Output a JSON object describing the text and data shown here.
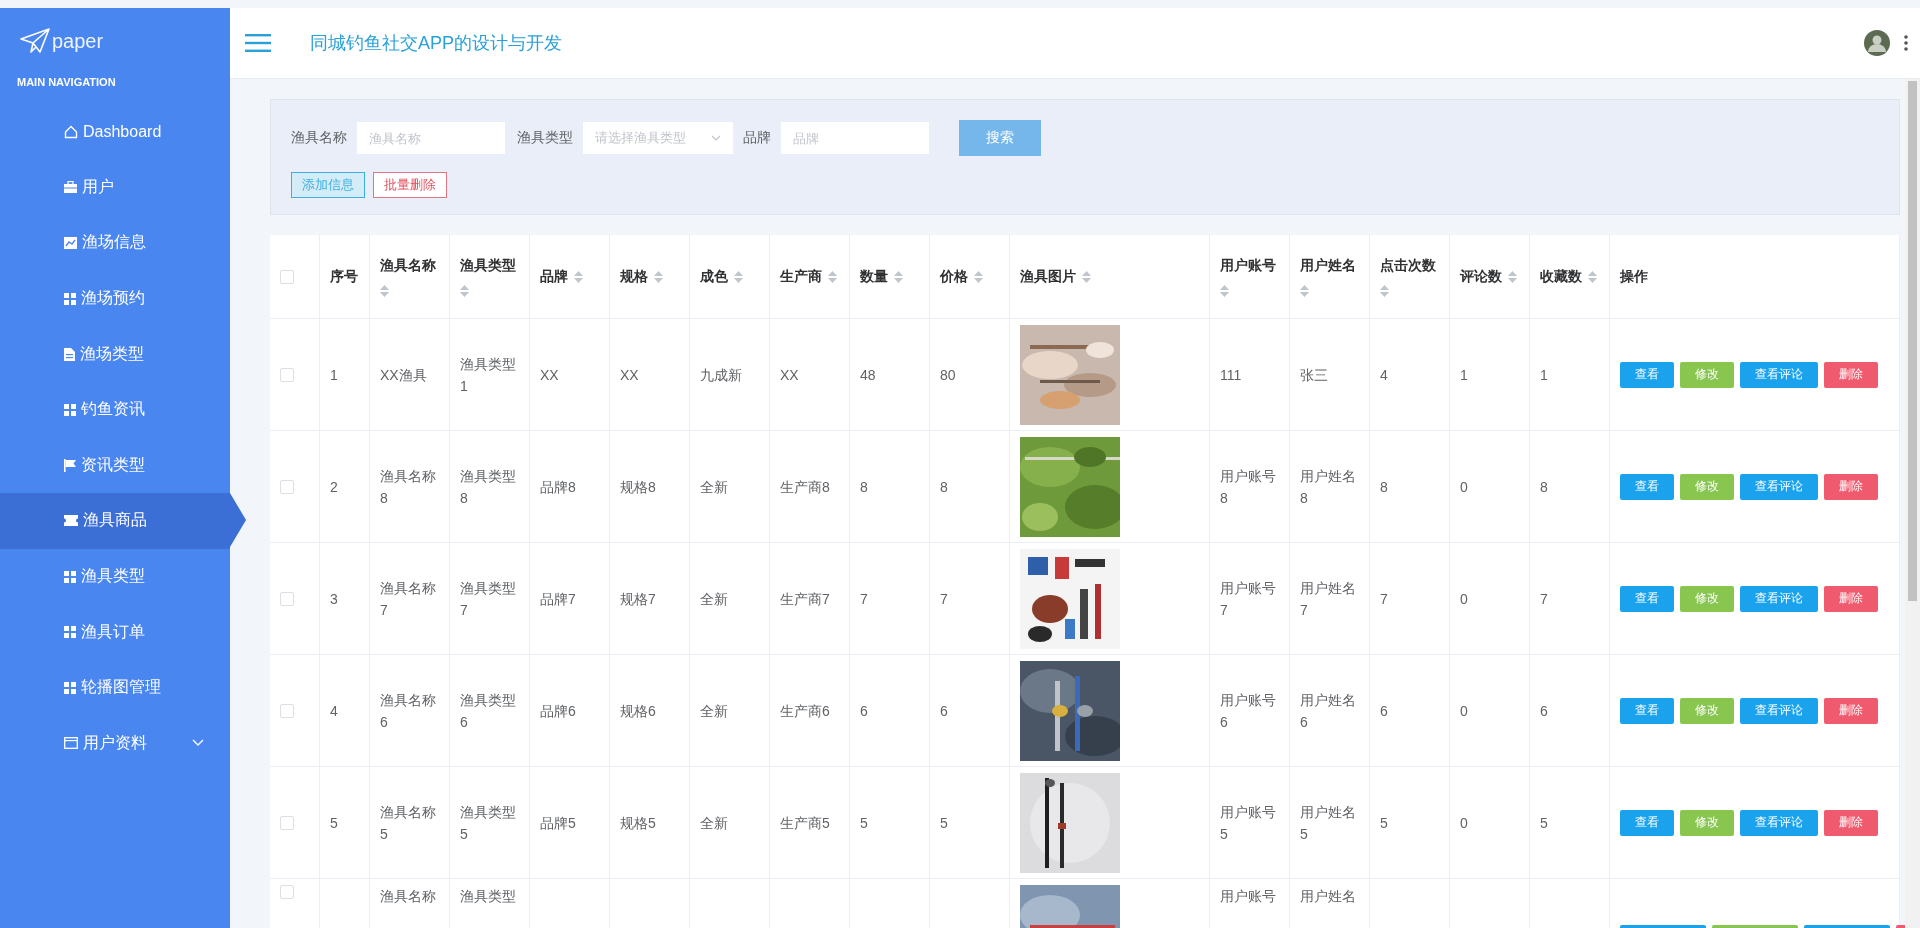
{
  "sidebar": {
    "logo": "paper",
    "heading": "MAIN NAVIGATION",
    "items": [
      {
        "label": "Dashboard",
        "selected": false
      },
      {
        "label": "用户",
        "selected": false
      },
      {
        "label": "渔场信息",
        "selected": false
      },
      {
        "label": "渔场预约",
        "selected": false
      },
      {
        "label": "渔场类型",
        "selected": false
      },
      {
        "label": "钓鱼资讯",
        "selected": false
      },
      {
        "label": "资讯类型",
        "selected": false
      },
      {
        "label": "渔具商品",
        "selected": true
      },
      {
        "label": "渔具类型",
        "selected": false
      },
      {
        "label": "渔具订单",
        "selected": false
      },
      {
        "label": "轮播图管理",
        "selected": false
      },
      {
        "label": "用户资料",
        "selected": false,
        "expanded": false
      }
    ]
  },
  "header": {
    "title": "同城钓鱼社交APP的设计与开发"
  },
  "filters": [
    {
      "label": "渔具名称",
      "kind": "input",
      "placeholder": "渔具名称"
    },
    {
      "label": "渔具类型",
      "kind": "select",
      "placeholder": "请选择渔具类型"
    },
    {
      "label": "品牌",
      "kind": "input",
      "placeholder": "品牌"
    }
  ],
  "search_button": "搜索",
  "toolbar": [
    {
      "label": "添加信息",
      "kind": "add"
    },
    {
      "label": "批量删除",
      "kind": "delete"
    }
  ],
  "table": {
    "header_checked": false,
    "columns": [
      {
        "kind": "check"
      },
      {
        "kind": "text",
        "label": "序号",
        "sortable": false
      },
      {
        "kind": "text",
        "label": "渔具名称",
        "sortable": true
      },
      {
        "kind": "text",
        "label": "渔具类型",
        "sortable": true
      },
      {
        "kind": "text",
        "label": "品牌",
        "sortable": true
      },
      {
        "kind": "text",
        "label": "规格",
        "sortable": true
      },
      {
        "kind": "text",
        "label": "成色",
        "sortable": true
      },
      {
        "kind": "text",
        "label": "生产商",
        "sortable": true
      },
      {
        "kind": "text",
        "label": "数量",
        "sortable": true
      },
      {
        "kind": "text",
        "label": "价格",
        "sortable": true
      },
      {
        "kind": "picture",
        "label": "渔具图片",
        "sortable": true
      },
      {
        "kind": "text",
        "label": "用户账号",
        "sortable": true
      },
      {
        "kind": "text",
        "label": "用户姓名",
        "sortable": true
      },
      {
        "kind": "text",
        "label": "点击次数",
        "sortable": true
      },
      {
        "kind": "text",
        "label": "评论数",
        "sortable": true
      },
      {
        "kind": "text",
        "label": "收藏数",
        "sortable": true
      },
      {
        "kind": "actions",
        "label": "操作",
        "sortable": false
      }
    ],
    "rows": [
      {
        "checked": false,
        "cells": [
          "",
          "1",
          "XX渔具",
          "渔具类型1",
          "XX",
          "XX",
          "九成新",
          "XX",
          "48",
          "80",
          "",
          "111",
          "张三",
          "4",
          "1",
          "1",
          ""
        ],
        "actions": [
          {
            "label": "查看",
            "kind": "view"
          },
          {
            "label": "修改",
            "kind": "edit"
          },
          {
            "label": "查看评论",
            "kind": "view"
          },
          {
            "label": "删除",
            "kind": "delete"
          }
        ]
      },
      {
        "checked": false,
        "cells": [
          "",
          "2",
          "渔具名称8",
          "渔具类型8",
          "品牌8",
          "规格8",
          "全新",
          "生产商8",
          "8",
          "8",
          "",
          "用户账号8",
          "用户姓名8",
          "8",
          "0",
          "8",
          ""
        ],
        "actions": [
          {
            "label": "查看",
            "kind": "view"
          },
          {
            "label": "修改",
            "kind": "edit"
          },
          {
            "label": "查看评论",
            "kind": "view"
          },
          {
            "label": "删除",
            "kind": "delete"
          }
        ]
      },
      {
        "checked": false,
        "cells": [
          "",
          "3",
          "渔具名称7",
          "渔具类型7",
          "品牌7",
          "规格7",
          "全新",
          "生产商7",
          "7",
          "7",
          "",
          "用户账号7",
          "用户姓名7",
          "7",
          "0",
          "7",
          ""
        ],
        "actions": [
          {
            "label": "查看",
            "kind": "view"
          },
          {
            "label": "修改",
            "kind": "edit"
          },
          {
            "label": "查看评论",
            "kind": "view"
          },
          {
            "label": "删除",
            "kind": "delete"
          }
        ]
      },
      {
        "checked": false,
        "cells": [
          "",
          "4",
          "渔具名称6",
          "渔具类型6",
          "品牌6",
          "规格6",
          "全新",
          "生产商6",
          "6",
          "6",
          "",
          "用户账号6",
          "用户姓名6",
          "6",
          "0",
          "6",
          ""
        ],
        "actions": [
          {
            "label": "查看",
            "kind": "view"
          },
          {
            "label": "修改",
            "kind": "edit"
          },
          {
            "label": "查看评论",
            "kind": "view"
          },
          {
            "label": "删除",
            "kind": "delete"
          }
        ]
      },
      {
        "checked": false,
        "cells": [
          "",
          "5",
          "渔具名称5",
          "渔具类型5",
          "品牌5",
          "规格5",
          "全新",
          "生产商5",
          "5",
          "5",
          "",
          "用户账号5",
          "用户姓名5",
          "5",
          "0",
          "5",
          ""
        ],
        "actions": [
          {
            "label": "查看",
            "kind": "view"
          },
          {
            "label": "修改",
            "kind": "edit"
          },
          {
            "label": "查看评论",
            "kind": "view"
          },
          {
            "label": "删除",
            "kind": "delete"
          }
        ]
      },
      {
        "checked": false,
        "cells": [
          "",
          "",
          "渔具名称",
          "渔具类型",
          "",
          "",
          "",
          "",
          "",
          "",
          "",
          "用户账号",
          "用户姓名",
          "",
          "",
          "",
          ""
        ],
        "actions": [
          {
            "kind": "view"
          },
          {
            "kind": "edit"
          },
          {
            "kind": "view"
          },
          {
            "kind": "delete"
          }
        ]
      }
    ]
  }
}
